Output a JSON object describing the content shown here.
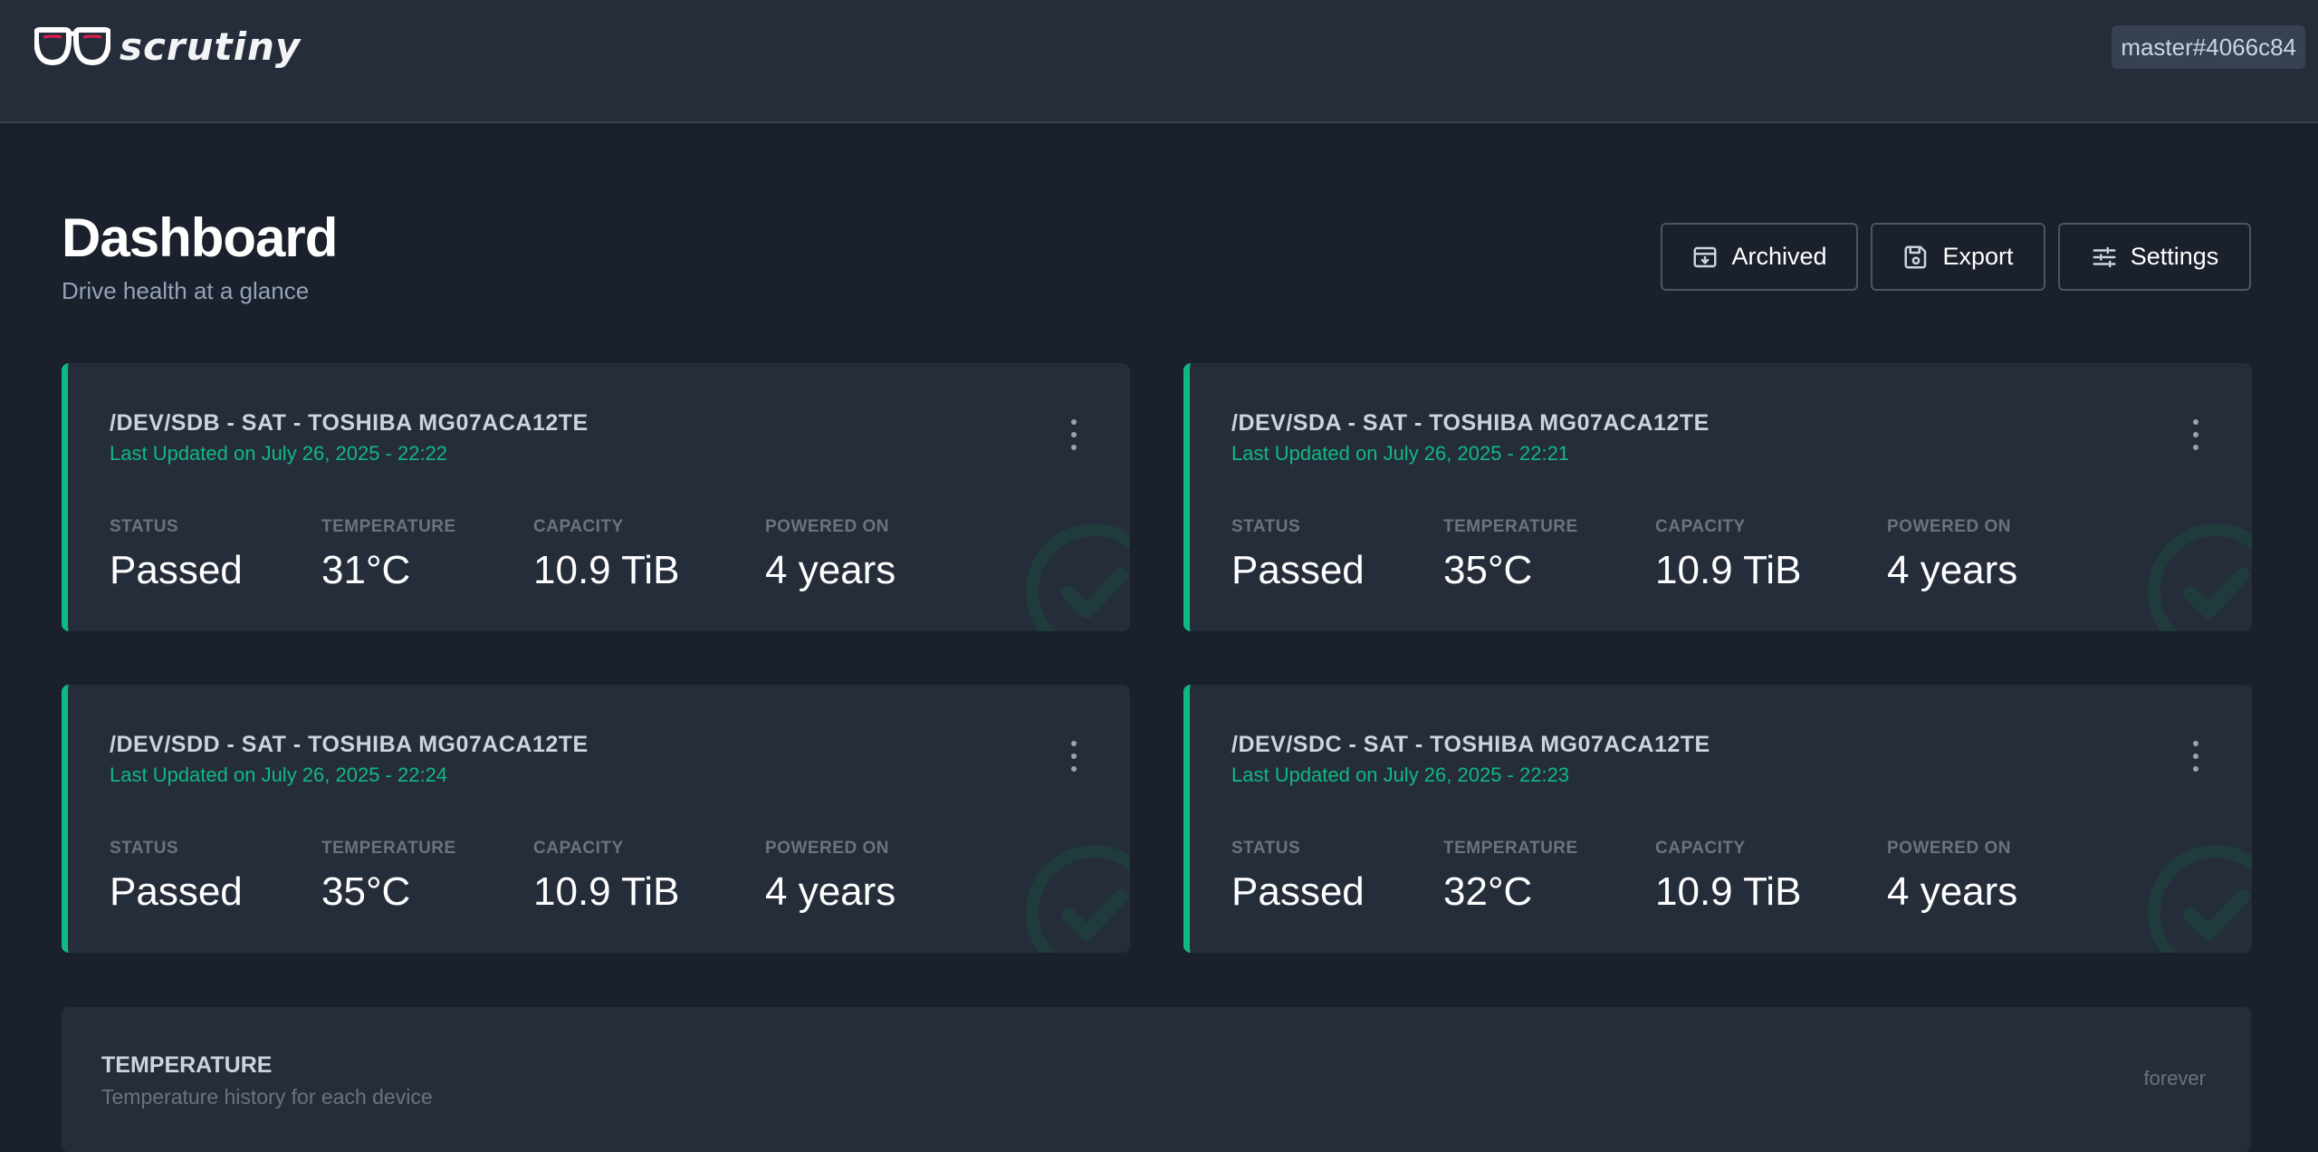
{
  "header": {
    "logo_text": "scrutiny",
    "version": "master#4066c84"
  },
  "page": {
    "title": "Dashboard",
    "subtitle": "Drive health at a glance"
  },
  "actions": {
    "archived": "Archived",
    "export": "Export",
    "settings": "Settings"
  },
  "stat_labels": {
    "status": "STATUS",
    "temperature": "TEMPERATURE",
    "capacity": "CAPACITY",
    "powered_on": "POWERED ON"
  },
  "devices": [
    {
      "title": "/DEV/SDB - SAT - TOSHIBA MG07ACA12TE",
      "updated": "Last Updated on July 26, 2025 - 22:22",
      "status": "Passed",
      "temperature": "31°C",
      "capacity": "10.9 TiB",
      "powered_on": "4 years"
    },
    {
      "title": "/DEV/SDA - SAT - TOSHIBA MG07ACA12TE",
      "updated": "Last Updated on July 26, 2025 - 22:21",
      "status": "Passed",
      "temperature": "35°C",
      "capacity": "10.9 TiB",
      "powered_on": "4 years"
    },
    {
      "title": "/DEV/SDD - SAT - TOSHIBA MG07ACA12TE",
      "updated": "Last Updated on July 26, 2025 - 22:24",
      "status": "Passed",
      "temperature": "35°C",
      "capacity": "10.9 TiB",
      "powered_on": "4 years"
    },
    {
      "title": "/DEV/SDC - SAT - TOSHIBA MG07ACA12TE",
      "updated": "Last Updated on July 26, 2025 - 22:23",
      "status": "Passed",
      "temperature": "32°C",
      "capacity": "10.9 TiB",
      "powered_on": "4 years"
    }
  ],
  "temperature_panel": {
    "title": "TEMPERATURE",
    "subtitle": "Temperature history for each device",
    "range": "forever"
  },
  "colors": {
    "background": "#1a202c",
    "card": "#252d3b",
    "passed_accent": "#10b981"
  },
  "icons": [
    "glasses-logo-icon",
    "archive-icon",
    "save-icon",
    "sliders-icon",
    "more-vertical-icon",
    "check-circle-icon"
  ]
}
